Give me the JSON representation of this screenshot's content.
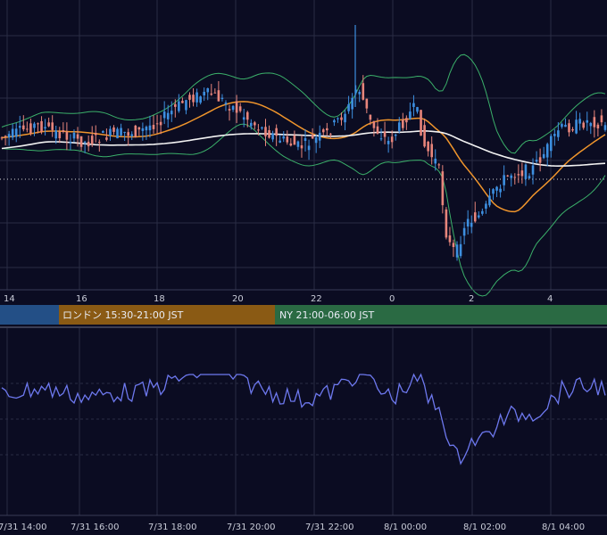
{
  "chart_data": [
    {
      "type": "candlestick",
      "title": "",
      "x_unit": "hours (JST)",
      "xlim": [
        13.8,
        5.6
      ],
      "ylim_note": "no price axis visible",
      "x_ticks": [
        "14",
        "16",
        "18",
        "20",
        "22",
        "0",
        "2",
        "4"
      ],
      "grid": true,
      "series": [
        {
          "name": "",
          "kind": "candles",
          "up_color": "#3d8fe0",
          "down_color": "#e7857b"
        },
        {
          "name": "",
          "kind": "bollinger_upper_lower",
          "color": "#3bb06a"
        },
        {
          "name": "",
          "kind": "moving_average",
          "color": "#f0952c"
        },
        {
          "name": "",
          "kind": "moving_average_long",
          "color": "#f2f2f2"
        }
      ],
      "reference_line": {
        "style": "dotted",
        "color": "#d8d8d8"
      }
    },
    {
      "type": "line",
      "title": "",
      "series": [
        {
          "name": "",
          "color": "#6d78ee"
        }
      ],
      "x_ticks": [
        "7/31 14:00",
        "7/31 16:00",
        "7/31 18:00",
        "7/31 20:00",
        "7/31 22:00",
        "8/1 00:00",
        "8/1 02:00",
        "8/1 04:00"
      ],
      "grid": true
    }
  ],
  "sessions": [
    {
      "label": "",
      "color": "#234f86"
    },
    {
      "label": "ロンドン 15:30-21:00 JST",
      "color": "#8a5a14"
    },
    {
      "label": "NY 21:00-06:00 JST",
      "color": "#2a6a43"
    }
  ],
  "colors": {
    "background": "#0b0c22",
    "grid": "#2a2c44",
    "axis_text": "#c9ccd8"
  }
}
